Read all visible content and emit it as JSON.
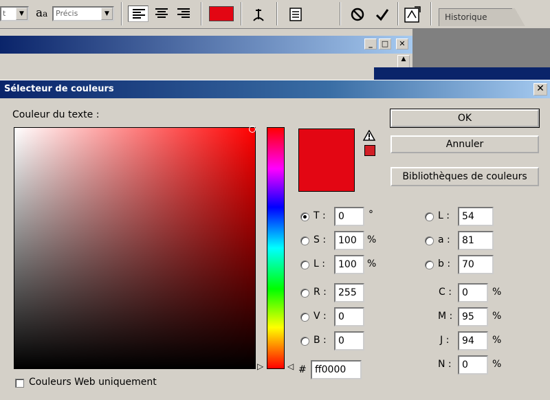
{
  "toolbar": {
    "font_style_partial": "t",
    "antialias_icon_label": "a",
    "antialias_icon_label_small": "a",
    "antialias_value": "Précis",
    "text_color": "#e30613",
    "history_tab": "Historique"
  },
  "dialog": {
    "title": "Sélecteur de couleurs",
    "field_label": "Couleur du texte :",
    "ok": "OK",
    "cancel": "Annuler",
    "libraries": "Bibliothèques de couleurs",
    "web_only": "Couleurs Web uniquement",
    "new_color": "#e30613",
    "gamut_color": "#d21f26",
    "hsb": [
      {
        "label": "T :",
        "value": "0",
        "unit": "°",
        "checked": true
      },
      {
        "label": "S :",
        "value": "100",
        "unit": "%",
        "checked": false
      },
      {
        "label": "L :",
        "value": "100",
        "unit": "%",
        "checked": false
      }
    ],
    "rgb": [
      {
        "label": "R :",
        "value": "255"
      },
      {
        "label": "V :",
        "value": "0"
      },
      {
        "label": "B :",
        "value": "0"
      }
    ],
    "lab": [
      {
        "label": "L :",
        "value": "54"
      },
      {
        "label": "a :",
        "value": "81"
      },
      {
        "label": "b :",
        "value": "70"
      }
    ],
    "cmyk": [
      {
        "label": "C :",
        "value": "0",
        "unit": "%"
      },
      {
        "label": "M :",
        "value": "95",
        "unit": "%"
      },
      {
        "label": "J :",
        "value": "94",
        "unit": "%"
      },
      {
        "label": "N :",
        "value": "0",
        "unit": "%"
      }
    ],
    "hex_label": "#",
    "hex": "ff0000"
  }
}
